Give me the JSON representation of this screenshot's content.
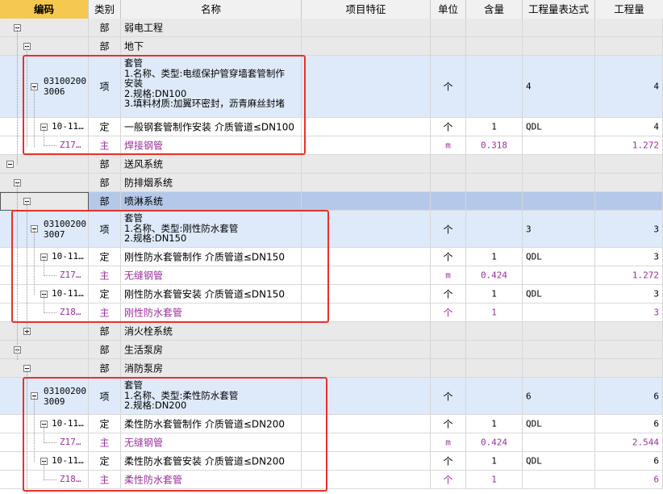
{
  "columns": {
    "code": "编码",
    "type": "类别",
    "name": "名称",
    "feature": "项目特征",
    "unit": "单位",
    "content": "含量",
    "expr": "工程量表达式",
    "qty": "工程量"
  },
  "rows": [
    {
      "kind": "bu",
      "type": "部",
      "name": "弱电工程"
    },
    {
      "kind": "bu",
      "type": "部",
      "name": "地下"
    },
    {
      "kind": "xiang",
      "code1": "03100200",
      "code2": "3006",
      "type": "项",
      "name_lines": [
        "套管",
        "1.名称、类型:电缆保护管穿墙套管制作",
        "安装",
        "2.规格:DN100",
        "3.填料材质:加翼环密封，沥青麻丝封堵"
      ],
      "unit": "个",
      "expr": "4",
      "qty": "4"
    },
    {
      "kind": "ding",
      "code": "10-11…",
      "type": "定",
      "name": "一般钢套管制作安装 介质管道≤DN100",
      "unit": "个",
      "content": "1",
      "expr": "QDL",
      "qty": "4"
    },
    {
      "kind": "zhu",
      "code": "Z17…",
      "type": "主",
      "name": "焊接钢管",
      "unit": "m",
      "content": "0.318",
      "qty": "1.272"
    },
    {
      "kind": "bu",
      "type": "部",
      "name": "送风系统"
    },
    {
      "kind": "bu",
      "type": "部",
      "name": "防排烟系统"
    },
    {
      "kind": "bu",
      "type": "部",
      "name": "喷淋系统"
    },
    {
      "kind": "xiang",
      "code1": "03100200",
      "code2": "3007",
      "type": "项",
      "name_lines": [
        "套管",
        "1.名称、类型:刚性防水套管",
        "2.规格:DN150"
      ],
      "unit": "个",
      "expr": "3",
      "qty": "3"
    },
    {
      "kind": "ding",
      "code": "10-11…",
      "type": "定",
      "name": "刚性防水套管制作 介质管道≤DN150",
      "unit": "个",
      "content": "1",
      "expr": "QDL",
      "qty": "3"
    },
    {
      "kind": "zhu",
      "code": "Z17…",
      "type": "主",
      "name": "无缝钢管",
      "unit": "m",
      "content": "0.424",
      "qty": "1.272"
    },
    {
      "kind": "ding",
      "code": "10-11…",
      "type": "定",
      "name": "刚性防水套管安装 介质管道≤DN150",
      "unit": "个",
      "content": "1",
      "expr": "QDL",
      "qty": "3"
    },
    {
      "kind": "zhu",
      "code": "Z18…",
      "type": "主",
      "name": "刚性防水套管",
      "unit": "个",
      "content": "1",
      "qty": "3"
    },
    {
      "kind": "bu",
      "type": "部",
      "name": "消火栓系统"
    },
    {
      "kind": "bu",
      "type": "部",
      "name": "生活泵房"
    },
    {
      "kind": "bu",
      "type": "部",
      "name": "消防泵房"
    },
    {
      "kind": "xiang",
      "code1": "03100200",
      "code2": "3009",
      "type": "项",
      "name_lines": [
        "套管",
        "1.名称、类型:柔性防水套管",
        "2.规格:DN200"
      ],
      "unit": "个",
      "expr": "6",
      "qty": "6"
    },
    {
      "kind": "ding",
      "code": "10-11…",
      "type": "定",
      "name": "柔性防水套管制作 介质管道≤DN200",
      "unit": "个",
      "content": "1",
      "expr": "QDL",
      "qty": "6"
    },
    {
      "kind": "zhu",
      "code": "Z17…",
      "type": "主",
      "name": "无缝钢管",
      "unit": "m",
      "content": "0.424",
      "qty": "2.544"
    },
    {
      "kind": "ding",
      "code": "10-11…",
      "type": "定",
      "name": "柔性防水套管安装 介质管道≤DN200",
      "unit": "个",
      "content": "1",
      "expr": "QDL",
      "qty": "6"
    },
    {
      "kind": "zhu",
      "code": "Z18…",
      "type": "主",
      "name": "柔性防水套管",
      "unit": "个",
      "content": "1",
      "qty": "6"
    }
  ]
}
